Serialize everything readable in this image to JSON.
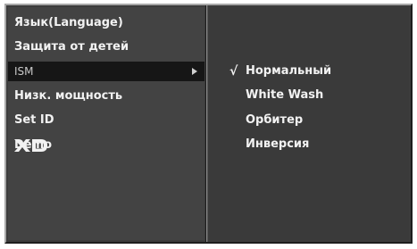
{
  "menu": {
    "items": [
      {
        "label": "Язык(Language)"
      },
      {
        "label": "Защита от детей"
      },
      {
        "label": "ISM"
      },
      {
        "label": "Низк. мощность"
      },
      {
        "label": "Set ID"
      },
      {
        "label": "Demo",
        "logo": "XD"
      }
    ],
    "selected_index": 2
  },
  "submenu": {
    "check_mark": "√",
    "items": [
      {
        "label": "Нормальный",
        "checked": true
      },
      {
        "label": "White Wash",
        "checked": false
      },
      {
        "label": "Орбитер",
        "checked": false
      },
      {
        "label": "Инверсия",
        "checked": false
      }
    ]
  },
  "icons": {
    "submenu_arrow": "right-triangle-arrow-icon",
    "xd_logo": "xd-logo-icon",
    "check": "checkmark-icon"
  },
  "colors": {
    "panel_bg": "#434343",
    "submenu_bg": "#3a3a3a",
    "selected_bg": "#161616",
    "text": "#f2f2f2"
  }
}
